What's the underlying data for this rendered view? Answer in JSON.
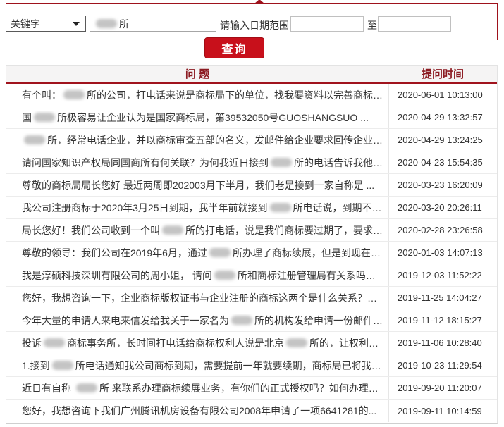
{
  "colors": {
    "accent_red": "#c8101b",
    "rule_red": "#9e121c",
    "header_red": "#a0131d",
    "header_text": "#8c1b22"
  },
  "search": {
    "keyword_select": {
      "selected": "关键字"
    },
    "keyword_input": {
      "visible_value": "所",
      "censored_prefix": true
    },
    "date_range_label": "请输入日期范围",
    "to_label": "至",
    "date_from_value": "",
    "date_to_value": "",
    "submit_label": "查询"
  },
  "table": {
    "headers": {
      "question": "问 题",
      "time": "提问时间"
    },
    "rows": [
      {
        "time": "2020-06-01 10:13:00",
        "parts": [
          {
            "text": "有个叫："
          },
          {
            "censored": true
          },
          {
            "text": "所的公司，打电话来说是商标局下的单位，找我要资料以完善商标注册。但我..."
          }
        ]
      },
      {
        "time": "2020-04-29 13:32:57",
        "parts": [
          {
            "text": "国"
          },
          {
            "censored": true
          },
          {
            "text": "所极容易让企业认为是国家商标局，第39532050号GUOSHANGSUO ..."
          }
        ]
      },
      {
        "time": "2020-04-29 13:24:25",
        "parts": [
          {
            "censored": true
          },
          {
            "text": "所，经常电话企业，并以商标审查五部的名义，发邮件给企业要求回传企业执照盖章扫..."
          }
        ]
      },
      {
        "time": "2020-04-23 15:54:35",
        "parts": [
          {
            "text": "请问国家知识产权局同国商所有何关联？为何我近日接到"
          },
          {
            "censored": true
          },
          {
            "text": "所的电话告诉我他们这边是知..."
          }
        ]
      },
      {
        "time": "2020-03-23 16:20:09",
        "parts": [
          {
            "text": "尊敬的商标局局长您好 最近两周即202003月下半月，我们老是接到一家自称是 ..."
          }
        ]
      },
      {
        "time": "2020-03-20 20:26:11",
        "parts": [
          {
            "text": "我公司注册商标于2020年3月25日到期，我半年前就接到"
          },
          {
            "censored": true
          },
          {
            "text": "所电话说，到期不用的..."
          }
        ]
      },
      {
        "time": "2020-02-28 23:26:58",
        "parts": [
          {
            "text": "局长您好！我们公司收到一个叫"
          },
          {
            "censored": true
          },
          {
            "text": "所的打电话，说是我们商标要过期了，要求我们寄资料..."
          }
        ]
      },
      {
        "time": "2020-01-03 14:07:13",
        "parts": [
          {
            "text": "尊敬的领导：我们公司在2019年6月，通过"
          },
          {
            "censored": true
          },
          {
            "text": "所办理了商标续展，但是到现在也没有..."
          }
        ]
      },
      {
        "time": "2019-12-03 11:52:22",
        "parts": [
          {
            "text": "我是淳硕科技深圳有限公司的周小姐， 请问"
          },
          {
            "censored": true
          },
          {
            "text": "所和商标注册管理局有关系吗？ 最..."
          }
        ]
      },
      {
        "time": "2019-11-25 14:04:27",
        "parts": [
          {
            "text": "您好，我想咨询一下，企业商标版权证书与企业注册的商标这两个是什么关系？现在我企业..."
          }
        ]
      },
      {
        "time": "2019-11-12 18:15:27",
        "parts": [
          {
            "text": "今年大量的申请人来电来信发给我关于一家名为"
          },
          {
            "censored": true
          },
          {
            "text": "所的机构发给申请一份邮件关于商标续..."
          }
        ]
      },
      {
        "time": "2019-11-06 10:28:40",
        "parts": [
          {
            "text": "投诉"
          },
          {
            "censored": true
          },
          {
            "text": "商标事务所，长时间打电话给商标权利人说是北京"
          },
          {
            "censored": true
          },
          {
            "text": "所的，让权利人对还未到续..."
          }
        ]
      },
      {
        "time": "2019-10-23 11:29:54",
        "parts": [
          {
            "text": "1.接到"
          },
          {
            "censored": true
          },
          {
            "text": "所电话通知我公司商标到期，需要提前一年就要续期，商标局已将我公司名单..."
          }
        ]
      },
      {
        "time": "2019-09-20 11:20:07",
        "parts": [
          {
            "text": "近日有自称 "
          },
          {
            "censored": true
          },
          {
            "text": "所 来联系办理商标续展业务，有你们的正式授权吗？如何办理商标续展..."
          }
        ]
      },
      {
        "time": "2019-09-11 10:14:59",
        "parts": [
          {
            "text": "您好，我想咨询下我们广州腾讯机房设备有限公司2008年申请了一项6641281的..."
          }
        ]
      }
    ]
  }
}
